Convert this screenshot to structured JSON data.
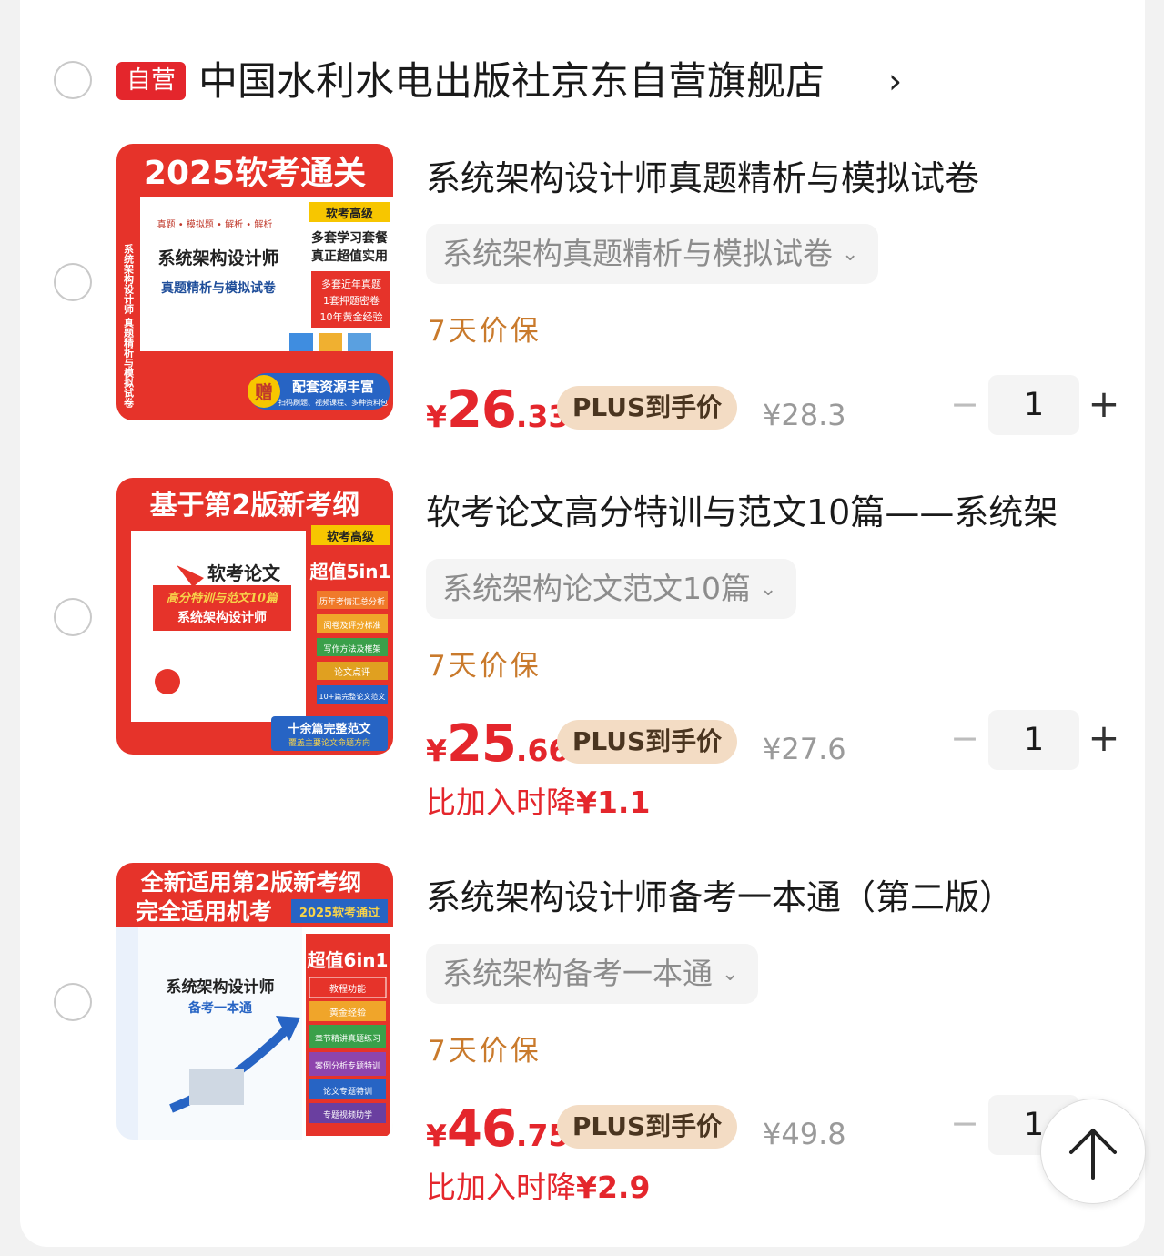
{
  "shop": {
    "badge": "自营",
    "name": "中国水利水电出版社京东自营旗舰店",
    "arrow": "›"
  },
  "items": [
    {
      "title": "系统架构设计师真题精析与模拟试卷",
      "variant": "系统架构真题精析与模拟试卷",
      "guarantee": "7天价保",
      "price_symbol": "¥",
      "price_int": "26",
      "price_dec": ".33",
      "plus_label": "PLUS到手价",
      "orig_price": "¥28.3",
      "qty": "1",
      "cover": {
        "banner": "2025软考通关",
        "level": "软考高级",
        "slogan1": "多套学习套餐",
        "slogan2": "真正超值实用",
        "book_title": "系统架构设计师",
        "book_sub": "真题精析与模拟试卷",
        "spine": "系统架构设计师 真题精析与模拟试卷",
        "tags": "真题 • 模拟题 • 解析 • 解析",
        "point1": "多套近年真题",
        "point2": "1套押题密卷",
        "point3": "10年黄金经验",
        "gift_badge": "赠",
        "gift": "配套资源丰富",
        "gift_sub": "扫码刷题、视频课程、多种资料包"
      }
    },
    {
      "title": "软考论文高分特训与范文10篇——系统架",
      "variant": "系统架构论文范文10篇",
      "guarantee": "7天价保",
      "price_symbol": "¥",
      "price_int": "25",
      "price_dec": ".66",
      "plus_label": "PLUS到手价",
      "orig_price": "¥27.6",
      "qty": "1",
      "drop_label": "比加入时降",
      "drop_value": "¥1.1",
      "cover": {
        "banner": "基于第2版新考纲",
        "level": "软考高级",
        "book_title": "软考论文",
        "book_sub": "高分特训与范文10篇",
        "book_sub2": "系统架构设计师",
        "combo": "超值5in1",
        "list": [
          "历年考情汇总分析",
          "阅卷及评分标准",
          "写作方法及框架",
          "论文点评",
          "10+篇完整论文范文"
        ],
        "footer": "十余篇完整范文",
        "footer_sub": "覆盖主要论文命题方向"
      }
    },
    {
      "title": "系统架构设计师备考一本通（第二版）",
      "variant": "系统架构备考一本通",
      "guarantee": "7天价保",
      "price_symbol": "¥",
      "price_int": "46",
      "price_dec": ".75",
      "plus_label": "PLUS到手价",
      "orig_price": "¥49.8",
      "qty": "1",
      "drop_label": "比加入时降",
      "drop_value": "¥2.9",
      "cover": {
        "banner1": "全新适用第2版新考纲",
        "banner2": "完全适用机考",
        "badge": "2025软考通过",
        "book_title": "系统架构设计师",
        "book_sub": "备考一本通",
        "combo": "超值6in1",
        "list": [
          "教程功能",
          "黄金经验",
          "章节精讲真题练习",
          "案例分析专题特训",
          "论文专题特训",
          "专题视频助学"
        ]
      }
    }
  ],
  "colors": {
    "accent_red": "#e4262c",
    "plus_bg": "#f3dcc4",
    "guarantee": "#c97a2c"
  },
  "icons": {
    "minus": "−",
    "plus": "+",
    "chevron": "⌄"
  }
}
